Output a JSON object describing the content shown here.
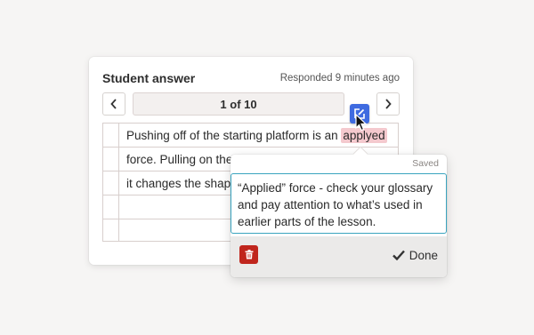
{
  "card": {
    "title": "Student answer",
    "meta": "Responded 9 minutes ago",
    "prev_label": "<",
    "next_label": ">",
    "page_indicator": "1 of 10"
  },
  "answer": {
    "line1_prefix": "Pushing off of the starting platform is an ",
    "line1_highlight": "applyed",
    "line2": "force. Pulling on the",
    "line3": "it changes the shape"
  },
  "popover": {
    "status": "Saved",
    "comment": "“Applied” force - check your glossary and pay attention to what’s used in earlier parts of the lesson.",
    "done_label": "Done"
  },
  "icons": {
    "edit": "edit-comment-icon",
    "delete": "trash-icon",
    "done": "checkmark-icon",
    "cursor": "pointer-cursor-icon"
  },
  "colors": {
    "highlight": "#f4c9ce",
    "edit_button": "#3f6be0",
    "delete_button": "#c0261d",
    "focus_border": "#3aa4bf"
  }
}
